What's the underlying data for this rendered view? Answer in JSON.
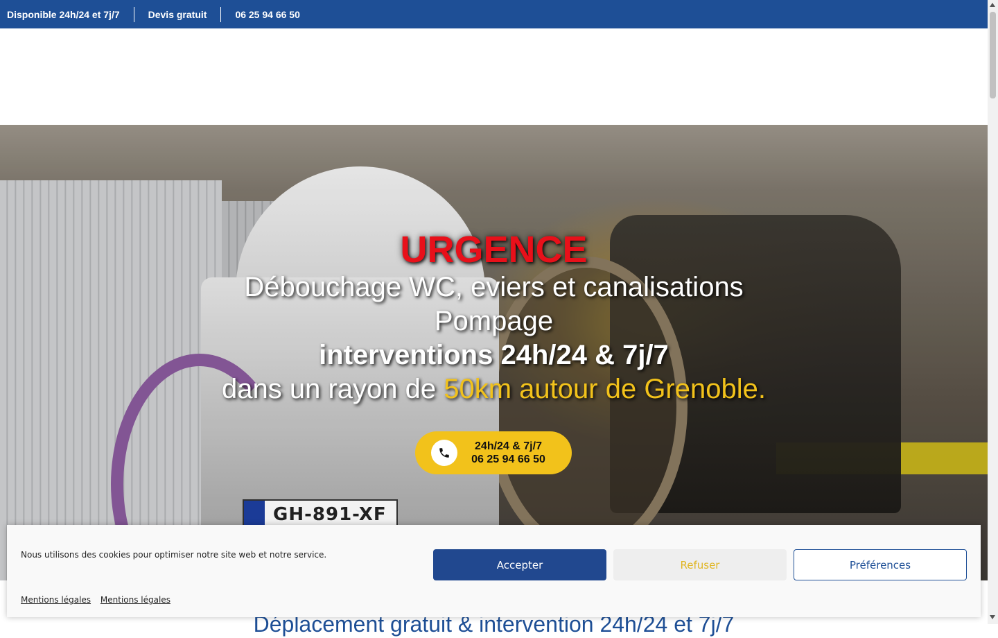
{
  "topbar": {
    "availability": "Disponible 24h/24 et 7j/7",
    "quote": "Devis gratuit",
    "phone": "06 25 94 66 50",
    "background_color": "#1e4f96"
  },
  "hero": {
    "urgence": "URGENCE",
    "line1": "Débouchage WC, eviers et canalisations",
    "line2": "Pompage",
    "line3": "interventions 24h/24 & 7j/7",
    "line4_prefix": "dans un rayon de ",
    "line4_highlight": "50km autour de Grenoble.",
    "plate_text": "GH-891-XF",
    "cta": {
      "icon": "phone-icon",
      "line1": "24h/24 & 7j/7",
      "line2": "06 25 94 66 50",
      "color": "#f2c21b"
    },
    "accent_red": "#e8101a",
    "accent_yellow": "#f2c21b"
  },
  "below": {
    "title": "Déplacement gratuit & intervention 24h/24 et 7j/7"
  },
  "cookie_banner": {
    "message": "Nous utilisons des cookies pour optimiser notre site web et notre service.",
    "accept_label": "Accepter",
    "refuse_label": "Refuser",
    "preferences_label": "Préférences",
    "links": [
      "Mentions légales",
      "Mentions légales"
    ],
    "accept_color": "#21488f"
  }
}
